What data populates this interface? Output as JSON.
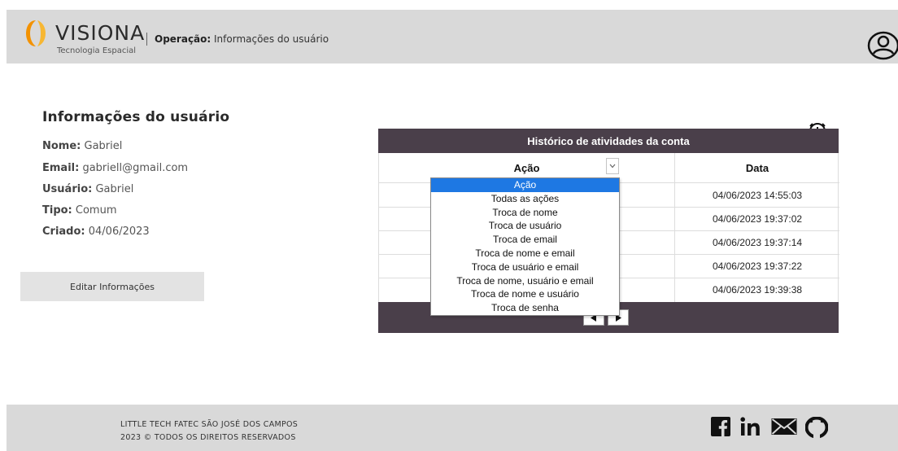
{
  "header": {
    "brand": "VISIONA",
    "brand_sub": "Tecnologia Espacial",
    "operation_label": "Operação:",
    "operation_value": " Informações do usuário",
    "user_icon": "user-profile-icon"
  },
  "user_info": {
    "title": "Informações do usuário",
    "fields": [
      {
        "label": "Nome:",
        "value": " Gabriel"
      },
      {
        "label": "Email:",
        "value": " gabriell@gmail.com"
      },
      {
        "label": "Usuário:",
        "value": " Gabriel"
      },
      {
        "label": "Tipo:",
        "value": " Comum"
      },
      {
        "label": "Criado:",
        "value": " 04/06/2023"
      }
    ],
    "edit_button": "Editar Informações"
  },
  "history": {
    "title": "Histórico de atividades da conta",
    "col_action": "Ação",
    "col_date": "Data",
    "dates": [
      "04/06/2023 14:55:03",
      "04/06/2023 19:37:02",
      "04/06/2023 19:37:14",
      "04/06/2023 19:37:22",
      "04/06/2023 19:39:38"
    ],
    "pager_prev": "◀",
    "pager_next": "▶"
  },
  "dropdown": {
    "options": [
      "Ação",
      "Todas as ações",
      "Troca de nome",
      "Troca de usuário",
      "Troca de email",
      "Troca de nome e email",
      "Troca de usuário e email",
      "Troca de nome, usuário e email",
      "Troca de nome e usuário",
      "Troca de senha"
    ],
    "selected": "Ação"
  },
  "footer": {
    "line1": "LITTLE TECH FATEC SÃO JOSÉ DOS CAMPOS",
    "line2": "2023 © TODOS OS DIREITOS RESERVADOS",
    "social_icons": [
      "facebook-icon",
      "linkedin-icon",
      "mail-icon",
      "github-icon"
    ]
  },
  "colors": {
    "header_bg": "#d9d9d9",
    "table_header_bg": "#4a3f4a",
    "selected_bg": "#1e78e3",
    "logo_orange": "#f39200"
  }
}
